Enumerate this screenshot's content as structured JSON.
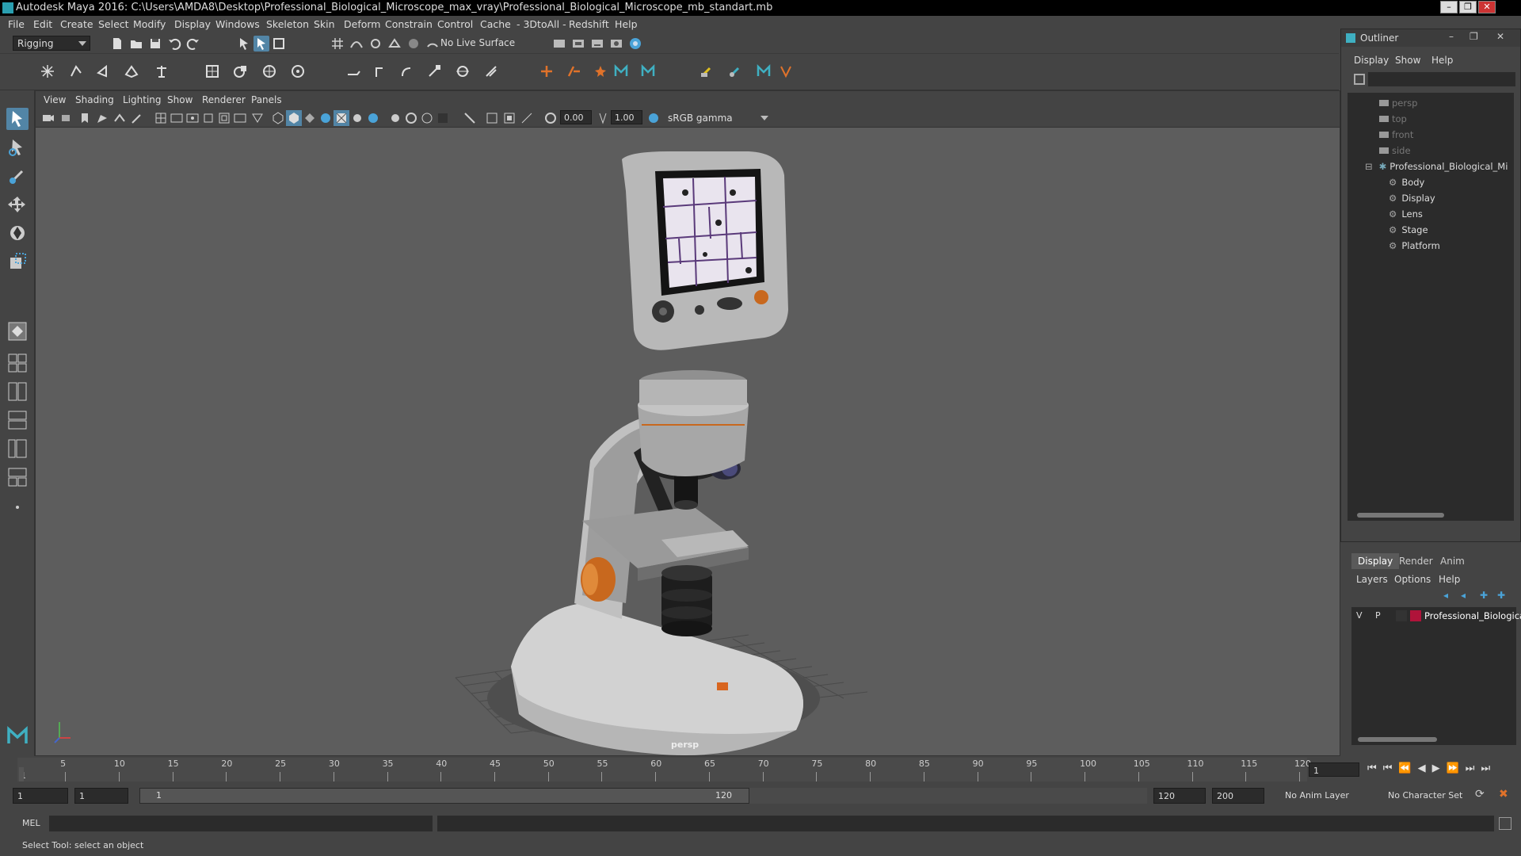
{
  "window": {
    "title": "Autodesk Maya 2016: C:\\Users\\AMDA8\\Desktop\\Professional_Biological_Microscope_max_vray\\Professional_Biological_Microscope_mb_standart.mb",
    "minimize": "–",
    "restore": "❐",
    "close": "✕"
  },
  "menubar": {
    "items": [
      "File",
      "Edit",
      "Create",
      "Select",
      "Modify",
      "Display",
      "Windows",
      "Skeleton",
      "Skin",
      "Deform",
      "Constrain",
      "Control",
      "Cache",
      "- 3DtoAll -",
      "Redshift",
      "Help"
    ]
  },
  "shelf": {
    "mode": "Rigging",
    "live_surface": "No Live Surface"
  },
  "viewport": {
    "menu": [
      "View",
      "Shading",
      "Lighting",
      "Show",
      "Renderer",
      "Panels"
    ],
    "near_value": "0.00",
    "far_value": "1.00",
    "color_space": "sRGB gamma",
    "camera_label": "persp"
  },
  "outliner": {
    "title": "Outliner",
    "menu": [
      "Display",
      "Show",
      "Help"
    ],
    "cameras": [
      "persp",
      "top",
      "front",
      "side"
    ],
    "root": "Professional_Biological_Mi",
    "children": [
      "Body",
      "Display",
      "Lens",
      "Stage",
      "Platform"
    ]
  },
  "layers": {
    "tabs": [
      "Display",
      "Render",
      "Anim"
    ],
    "active_tab": "Display",
    "menu": [
      "Layers",
      "Options",
      "Help"
    ],
    "layer": {
      "v": "V",
      "p": "P",
      "name": "Professional_Biologica",
      "color": "#b0133a"
    }
  },
  "timeline": {
    "ticks": [
      "5",
      "10",
      "15",
      "20",
      "25",
      "30",
      "35",
      "40",
      "45",
      "50",
      "55",
      "60",
      "65",
      "70",
      "75",
      "80",
      "85",
      "90",
      "95",
      "100",
      "105",
      "110",
      "115",
      "120"
    ],
    "start_label": "1",
    "current_frame": "1"
  },
  "range": {
    "start": "1",
    "playback_start": "1",
    "range_start_label": "1",
    "range_end_label": "120",
    "playback_end": "120",
    "end": "200",
    "anim_layer": "No Anim Layer",
    "character_set": "No Character Set"
  },
  "cmd": {
    "lang": "MEL"
  },
  "help": {
    "text": "Select Tool: select an object"
  },
  "colors": {
    "accent": "#5285a6",
    "brand": "#2a9fb0",
    "layer": "#b0133a"
  }
}
